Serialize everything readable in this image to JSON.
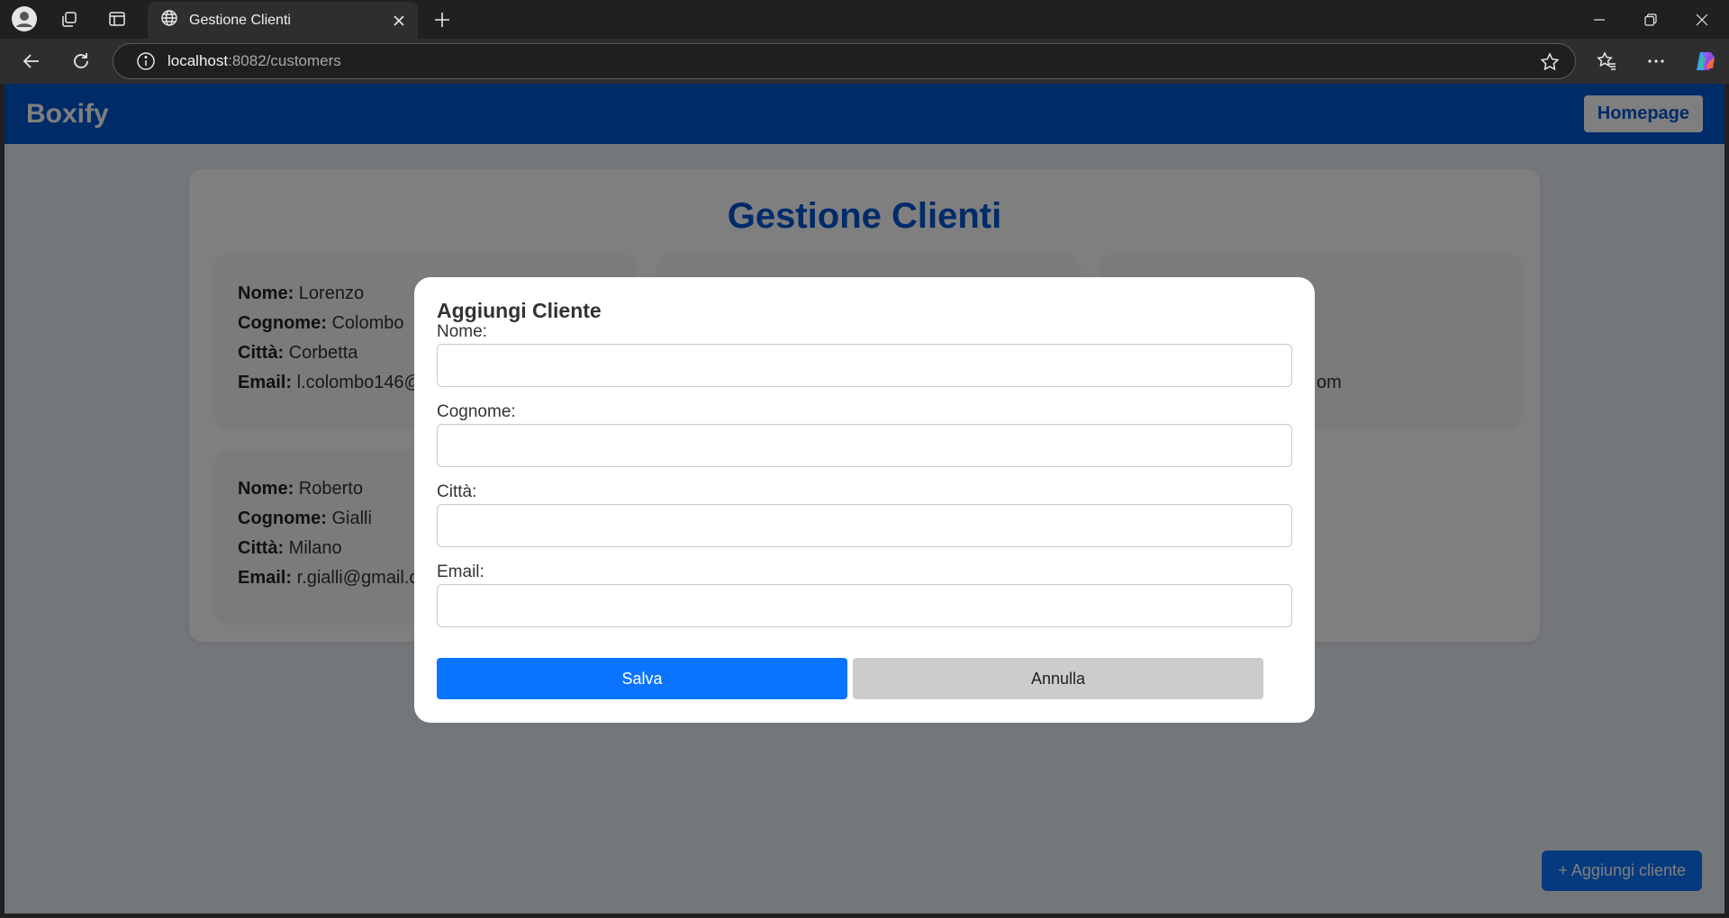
{
  "browser": {
    "tab_title": "Gestione Clienti",
    "url_host": "localhost",
    "url_rest": ":8082/customers"
  },
  "navbar": {
    "brand": "Boxify",
    "home_label": "Homepage"
  },
  "page": {
    "title": "Gestione Clienti",
    "add_button": "+ Aggiungi cliente"
  },
  "cards": [
    {
      "nome_label": "Nome:",
      "nome": "Lorenzo",
      "cognome_label": "Cognome:",
      "cognome": "Colombo",
      "citta_label": "Città:",
      "citta": "Corbetta",
      "email_label": "Email:",
      "email": "l.colombo146@"
    },
    {
      "nome_label": "",
      "nome": "",
      "cognome_label": "",
      "cognome": "",
      "citta_label": "",
      "citta": "",
      "email_label": "",
      "email": ""
    },
    {
      "nome_label": "",
      "nome": "",
      "cognome_label": "",
      "cognome": "",
      "citta_label": "",
      "citta": "",
      "email_label": "",
      "email": "om"
    },
    {
      "nome_label": "Nome:",
      "nome": "Roberto",
      "cognome_label": "Cognome:",
      "cognome": "Gialli",
      "citta_label": "Città:",
      "citta": "Milano",
      "email_label": "Email:",
      "email": "r.gialli@gmail.c"
    }
  ],
  "modal": {
    "title": "Aggiungi Cliente",
    "fields": [
      {
        "label": "Nome:",
        "value": ""
      },
      {
        "label": "Cognome:",
        "value": ""
      },
      {
        "label": "Città:",
        "value": ""
      },
      {
        "label": "Email:",
        "value": ""
      }
    ],
    "save_label": "Salva",
    "cancel_label": "Annulla"
  },
  "colors": {
    "brand_blue": "#0056d2",
    "button_blue": "#0a74ff",
    "cancel_gray": "#cccccc"
  }
}
